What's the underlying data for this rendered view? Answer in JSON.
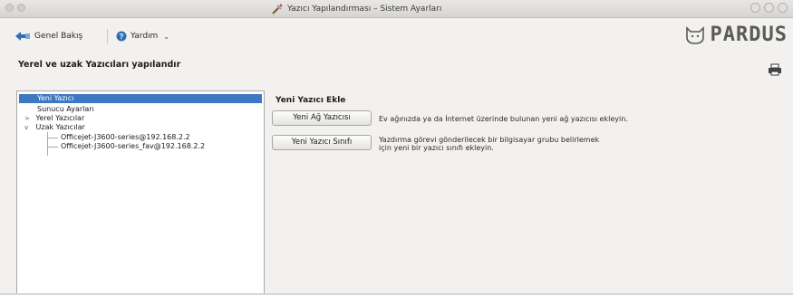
{
  "window": {
    "title": "Yazıcı Yapılandırması – Sistem Ayarları"
  },
  "toolbar": {
    "overview_label": "Genel Bakış",
    "help_label": "Yardım"
  },
  "brand": {
    "logo_text": "PARDUS"
  },
  "page": {
    "heading": "Yerel ve uzak Yazıcıları yapılandır"
  },
  "tree": {
    "items": [
      {
        "label": "Yeni Yazıcı",
        "selected": true
      },
      {
        "label": "Sunucu Ayarları"
      },
      {
        "label": "Yerel Yazıcılar",
        "arrow": ">"
      },
      {
        "label": "Uzak Yazıcılar",
        "arrow": "v"
      },
      {
        "label": "Officejet-J3600-series@192.168.2.2"
      },
      {
        "label": "Officejet-J3600-series_fav@192.168.2.2"
      }
    ]
  },
  "panel": {
    "section_title": "Yeni Yazıcı Ekle",
    "network_button": "Yeni Ağ Yazıcısı",
    "network_desc": "Ev ağınızda ya da İnternet üzerinde bulunan yeni ağ yazıcısı ekleyin.",
    "class_button": "Yeni Yazıcı Sınıfı",
    "class_desc_line1": "Yazdırma görevi gönderilecek bir bilgisayar grubu belirlemek",
    "class_desc_line2": "için yeni bir yazıcı sınıfı ekleyin."
  },
  "colors": {
    "selection": "#3c78c4",
    "window_bg": "#f2f1ef"
  }
}
